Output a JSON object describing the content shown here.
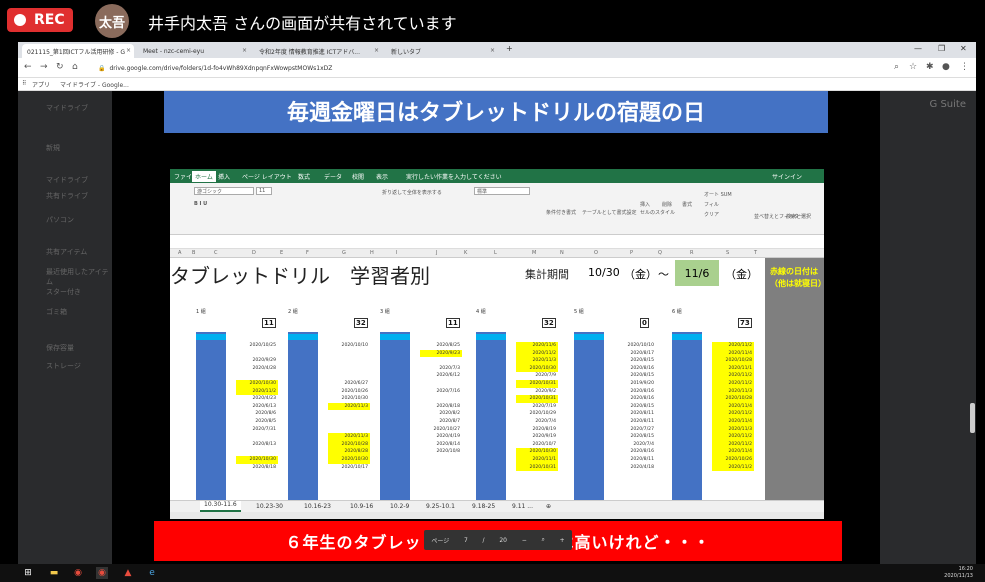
{
  "meeting": {
    "rec_label": "REC",
    "presenter_initials": "太吾",
    "share_status": "井手内太吾 さんの画面が共有されています"
  },
  "browser": {
    "tabs": [
      {
        "label": "021115_第1回ICTフル活用研修 - G"
      },
      {
        "label": "Meet - nzc-cemi-eyu"
      },
      {
        "label": "令和2年度 情報教育推進 ICTアドバ..."
      },
      {
        "label": "新しいタブ"
      }
    ],
    "new_tab": "+",
    "url": "drive.google.com/drive/folders/1d-fo4vWh89XdnpqnFxWowpstMOWs1xDZ",
    "bookmarks": [
      "アプリ",
      "マイドライブ - Google..."
    ]
  },
  "drive": {
    "brand": "G Suite",
    "side_items": [
      "新規",
      "マイドライブ",
      "共有ドライブ",
      "パソコン",
      "共有アイテム",
      "最近使用したアイテム",
      "スター付き",
      "ゴミ箱",
      "保存容量",
      "ストレージ"
    ]
  },
  "slide": {
    "banner": "毎週金曜日はタブレットドリルの宿題の日",
    "caption": "６年生のタブレットドリルの使用率は高いけれど・・・",
    "excel": {
      "ribbon_tabs": [
        "ファイル",
        "ホーム",
        "挿入",
        "ページ レイアウト",
        "数式",
        "データ",
        "校閲",
        "表示",
        "実行したい作業を入力してください"
      ],
      "signin": "サインイン",
      "font_name": "游ゴシック",
      "font_size": "11",
      "ribbon_labels": [
        "折り返して全体を表示する",
        "標準",
        "条件付き書式",
        "テーブルとして書式設定",
        "セルのスタイル",
        "挿入",
        "削除",
        "書式",
        "オート SUM",
        "フィル",
        "クリア",
        "並べ替えとフィルター",
        "検索と選択"
      ],
      "columns": [
        "A",
        "B",
        "C",
        "D",
        "E",
        "F",
        "G",
        "H",
        "I",
        "J",
        "K",
        "L",
        "M",
        "N",
        "O",
        "P",
        "Q",
        "R",
        "S",
        "T"
      ],
      "sheet_title": "タブレットドリル　学習者別",
      "period_label": "集計期間",
      "period_from": "10/30",
      "period_from_dow": "（金）",
      "period_sep": "～",
      "period_to": "11/6",
      "period_to_dow": "（金）",
      "side_note": "赤線の日付は\n（他は就寝日）",
      "groups": [
        {
          "name": "1 組",
          "count": "11"
        },
        {
          "name": "2 組",
          "count": "32"
        },
        {
          "name": "3 組",
          "count": "11"
        },
        {
          "name": "4 組",
          "count": "32"
        },
        {
          "name": "5 組",
          "count": "0"
        },
        {
          "name": "6 組",
          "count": "73"
        }
      ],
      "sheet_tabs": [
        "10.30-11.6",
        "10.23-30",
        "10.16-23",
        "10.9-16",
        "10.2-9",
        "9.25-10.1",
        "9.18-25",
        "9.11 ..."
      ],
      "group_dates": [
        [
          "2020/10/25",
          "",
          "2020/9/29",
          "2020/4/28",
          "",
          "2020/10/30",
          "2020/11/2",
          "2020/4/23",
          "2020/6/13",
          "2020/8/6",
          "2020/8/5",
          "2020/7/31",
          "",
          "2020/8/13",
          "",
          "2020/10/30",
          "2020/8/18"
        ],
        [
          "2020/10/10",
          "",
          "",
          "",
          "",
          "2020/6/27",
          "2020/10/26",
          "2020/10/30",
          "2020/11/3",
          "",
          "",
          "",
          "2020/11/3",
          "2020/10/28",
          "2020/8/28",
          "2020/10/30",
          "2020/10/17"
        ],
        [
          "2020/8/25",
          "2020/9/23",
          "",
          "2020/7/3",
          "2020/6/12",
          "",
          "2020/7/16",
          "",
          "2020/8/18",
          "2020/8/2",
          "2020/8/7",
          "2020/10/27",
          "2020/4/19",
          "2020/8/14",
          "2020/10/8",
          "",
          ""
        ],
        [
          "2020/11/6",
          "2020/11/2",
          "2020/11/3",
          "2020/10/30",
          "2020/7/9",
          "2020/10/31",
          "2020/9/2",
          "2020/10/31",
          "2020/7/19",
          "2020/10/29",
          "2020/7/4",
          "2020/8/19",
          "2020/9/19",
          "2020/10/7",
          "2020/10/30",
          "2020/11/1",
          "2020/10/31"
        ],
        [
          "2020/10/10",
          "2020/8/17",
          "2020/8/15",
          "2020/8/16",
          "2020/8/15",
          "2019/9/20",
          "2020/8/16",
          "2020/8/16",
          "2020/8/15",
          "2020/8/11",
          "2020/8/11",
          "2020/7/27",
          "2020/8/15",
          "2020/7/4",
          "2020/8/16",
          "2020/8/11",
          "2020/4/18"
        ],
        [
          "2020/11/2",
          "2020/11/4",
          "2020/10/28",
          "2020/11/1",
          "2020/11/2",
          "2020/11/2",
          "2020/11/3",
          "2020/10/28",
          "2020/11/4",
          "2020/11/2",
          "2020/11/4",
          "2020/11/3",
          "2020/11/2",
          "2020/11/2",
          "2020/11/4",
          "2020/10/26",
          "2020/11/2"
        ]
      ]
    },
    "pagebar": {
      "page_label": "ページ",
      "page": "7",
      "total": "20"
    }
  },
  "taskbar": {
    "time": "16:20",
    "date": "2020/11/13"
  },
  "colors": {
    "rec_red": "#e02f2f",
    "banner_blue": "#4472c4",
    "excel_green": "#217346",
    "caption_red": "#ff0000",
    "highlight_yellow": "#ffff00"
  }
}
